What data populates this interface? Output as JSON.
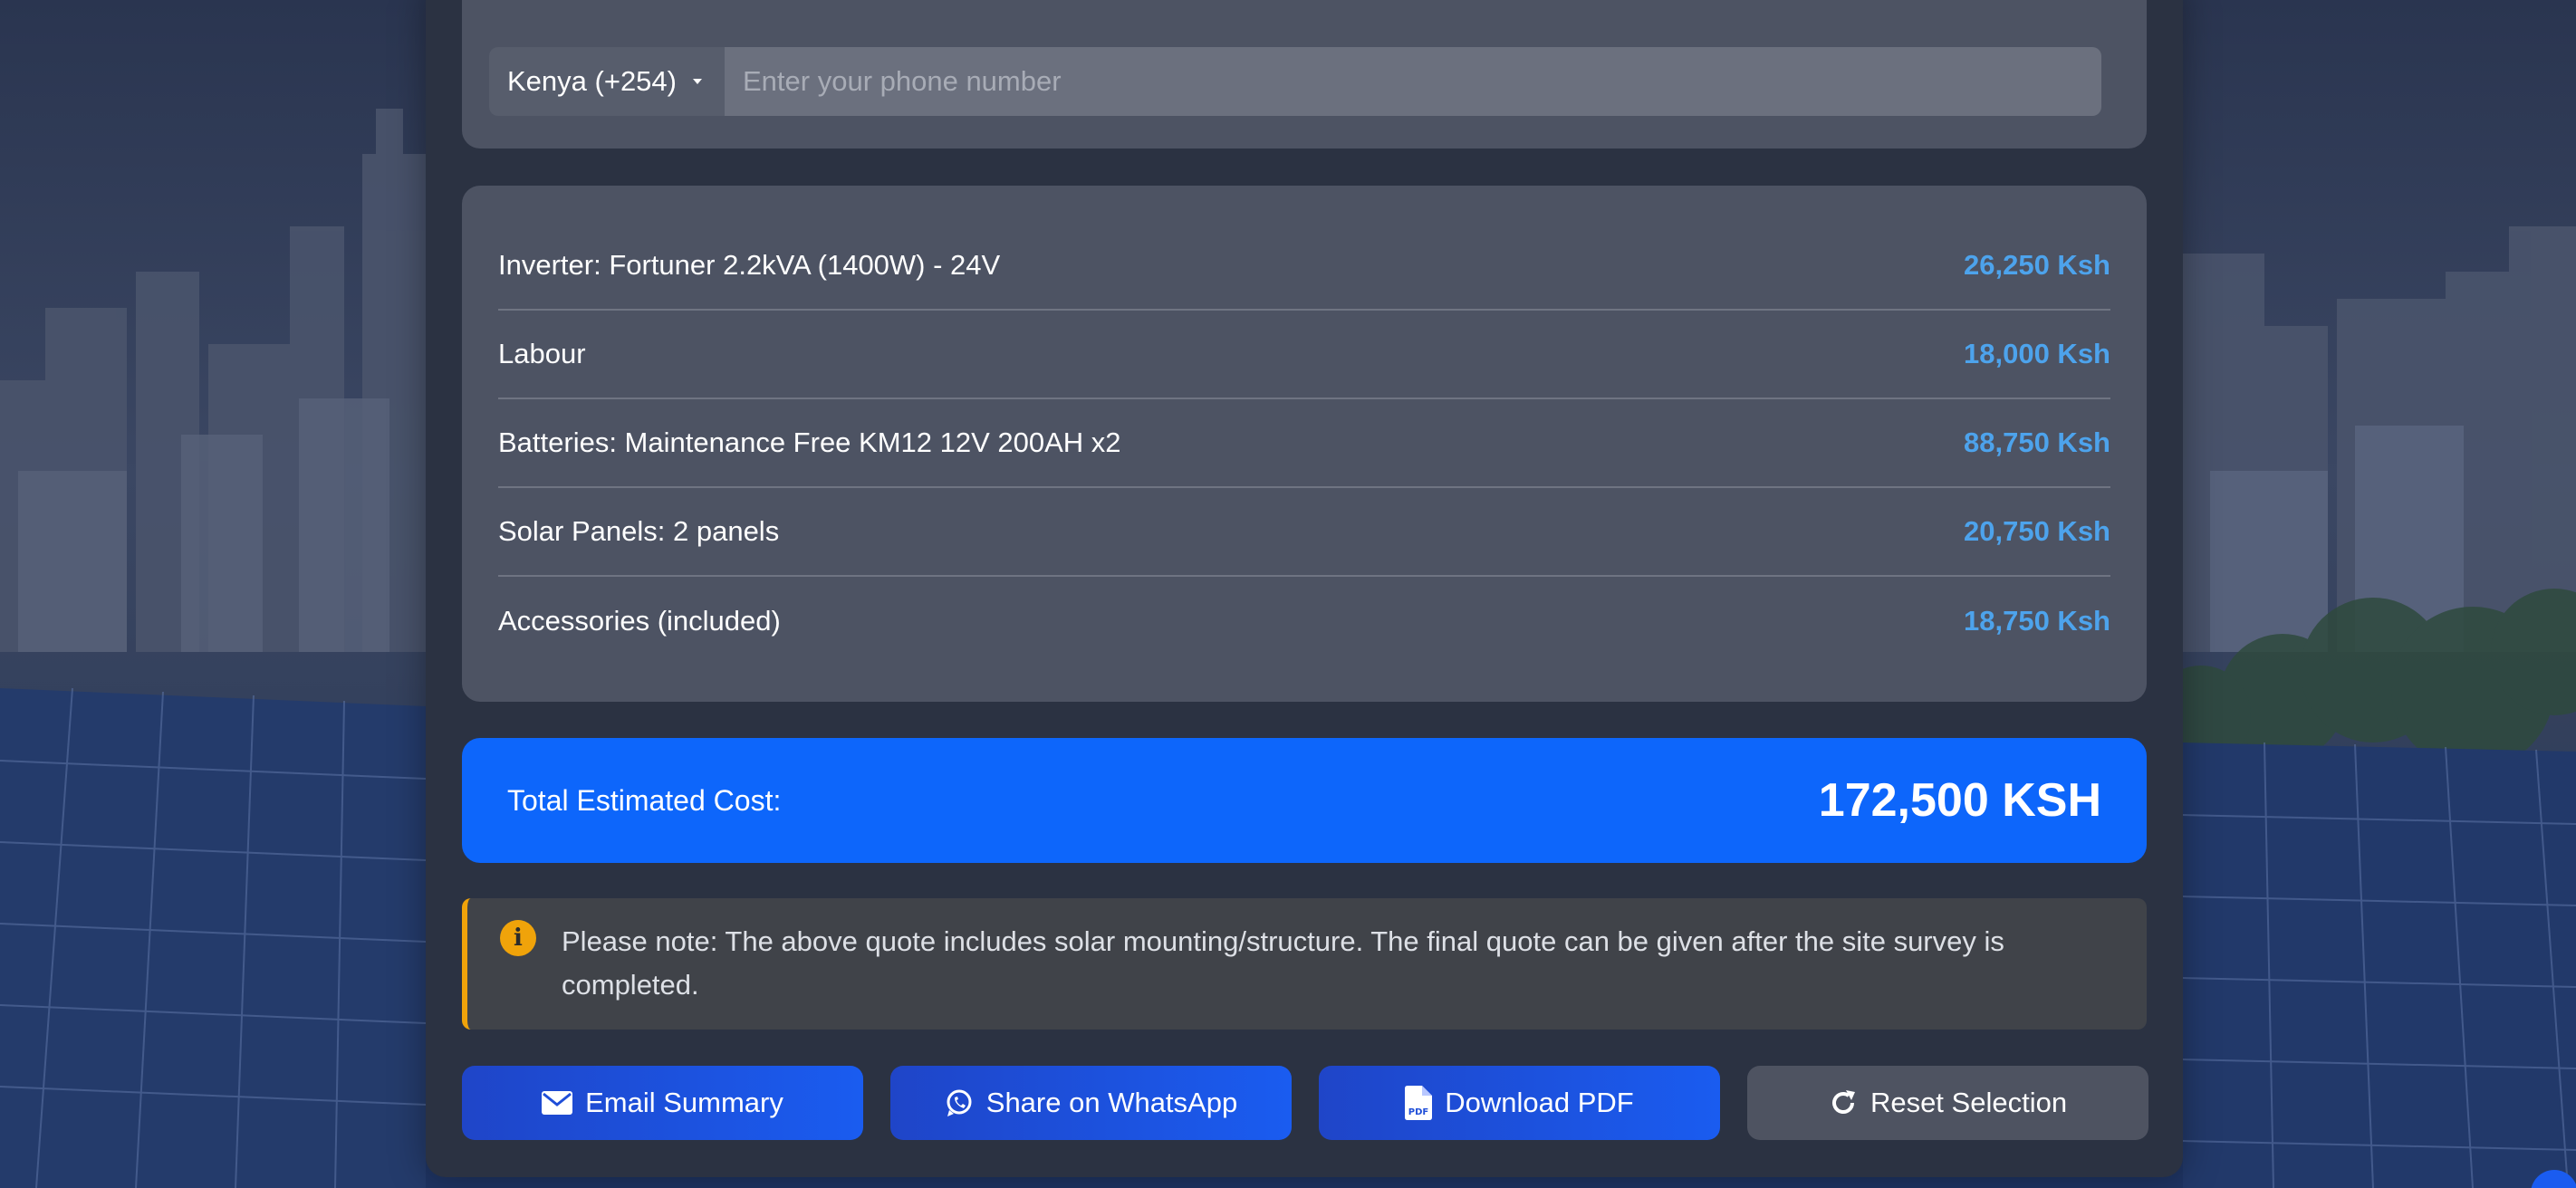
{
  "phone": {
    "country_label": "Kenya (+254)",
    "placeholder": "Enter your phone number",
    "value": ""
  },
  "items": [
    {
      "name": "Inverter: Fortuner 2.2kVA (1400W) - 24V",
      "price": "26,250 Ksh"
    },
    {
      "name": "Labour",
      "price": "18,000 Ksh"
    },
    {
      "name": "Batteries: Maintenance Free KM12 12V 200AH x2",
      "price": "88,750 Ksh"
    },
    {
      "name": "Solar Panels: 2 panels",
      "price": "20,750 Ksh"
    },
    {
      "name": "Accessories (included)",
      "price": "18,750 Ksh"
    }
  ],
  "total": {
    "label": "Total Estimated Cost:",
    "value": "172,500 KSH"
  },
  "note": {
    "icon": "info-circle-icon",
    "text": "Please note: The above quote includes solar mounting/structure. The final quote can be given after the site survey is completed."
  },
  "actions": {
    "email": {
      "label": "Email Summary",
      "icon": "envelope-icon"
    },
    "whatsapp": {
      "label": "Share on WhatsApp",
      "icon": "whatsapp-icon"
    },
    "pdf": {
      "label": "Download PDF",
      "icon": "pdf-file-icon"
    },
    "reset": {
      "label": "Reset Selection",
      "icon": "refresh-icon"
    }
  },
  "colors": {
    "accent_blue": "#0d66fb",
    "price_blue": "#4da3ec",
    "note_amber": "#f0a30a",
    "card_bg": "#2b3242",
    "panel_bg": "#4d5363"
  }
}
